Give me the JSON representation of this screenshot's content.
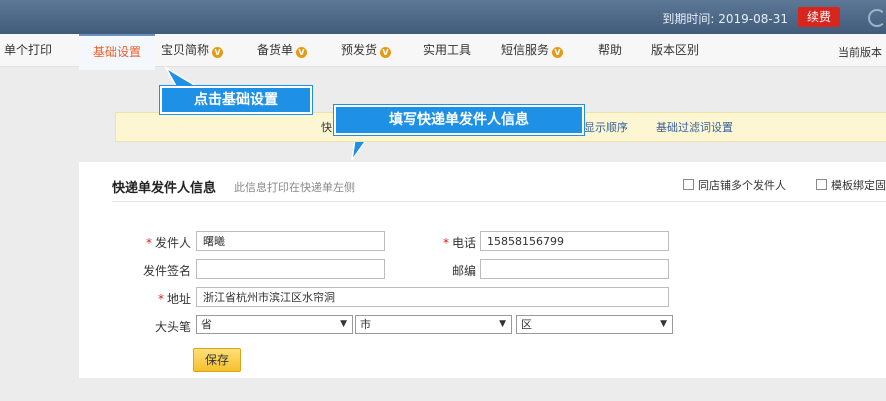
{
  "header": {
    "expiry_text": "到期时间: 2019-08-31",
    "renew_label": "续费"
  },
  "menu": {
    "items": [
      {
        "label": "单个打印",
        "badge": false
      },
      {
        "label": "基础设置",
        "badge": false,
        "active": true
      },
      {
        "label": "宝贝简称",
        "badge": true
      },
      {
        "label": "备货单",
        "badge": true
      },
      {
        "label": "预发货",
        "badge": true
      },
      {
        "label": "实用工具",
        "badge": false
      },
      {
        "label": "短信服务",
        "badge": true
      },
      {
        "label": "帮助",
        "badge": false
      },
      {
        "label": "版本区别",
        "badge": false
      }
    ],
    "badge_glyph": "V",
    "current_version": "当前版本"
  },
  "callouts": {
    "basic_settings": "点击基础设置",
    "fill_sender": "填写快递单发件人信息"
  },
  "subnav": {
    "partial_left": "快",
    "display_order": "显示顺序",
    "filter_settings": "基础过滤词设置"
  },
  "panel": {
    "title": "快递单发件人信息",
    "subtitle": "此信息打印在快递单左侧",
    "multi_sender_label": "同店铺多个发件人",
    "bind_template_label": "模板绑定固"
  },
  "form": {
    "sender_label": "发件人",
    "sender_value": "曙曦",
    "phone_label": "电话",
    "phone_value": "15858156799",
    "signature_label": "发件签名",
    "signature_value": "",
    "zip_label": "邮编",
    "zip_value": "",
    "address_label": "地址",
    "address_value": "浙江省杭州市滨江区水帘洞",
    "region_label": "大头笔",
    "province": "省",
    "city": "市",
    "district": "区",
    "dropdown_glyph": "▼",
    "required_mark": "*",
    "save_label": "保存"
  },
  "colors": {
    "topbar": "#4a6686",
    "renew": "#d8261f",
    "callout": "#1e90e6",
    "active_tab_text": "#e8612c",
    "save_button": "#f5c02c"
  }
}
